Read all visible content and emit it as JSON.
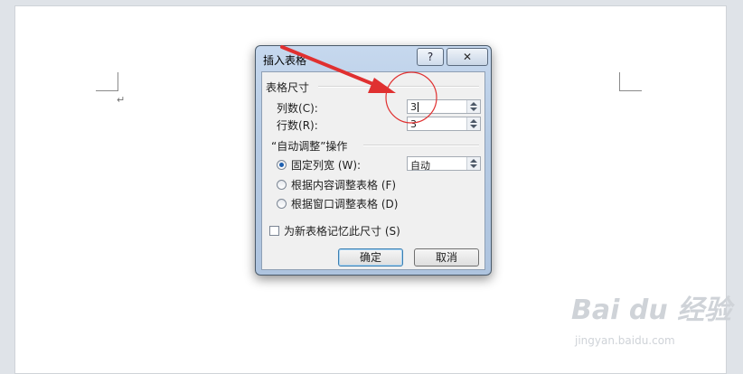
{
  "document": {
    "paragraph_mark": "↵"
  },
  "dialog": {
    "title": "插入表格",
    "help_button": "?",
    "close_button": "✕",
    "table_size": {
      "group_label": "表格尺寸",
      "columns_label": "列数",
      "columns_shortcut": "(C):",
      "columns_value": "3",
      "rows_label": "行数",
      "rows_shortcut": "(R):",
      "rows_value": "3"
    },
    "autofit": {
      "group_label": "“自动调整”操作",
      "options": [
        {
          "label": "固定列宽 (W):",
          "selected": true
        },
        {
          "label": "根据内容调整表格 (F)",
          "selected": false
        },
        {
          "label": "根据窗口调整表格 (D)",
          "selected": false
        }
      ],
      "fixed_width_value": "自动"
    },
    "remember_dimensions": {
      "label": "为新表格记忆此尺寸 (S)",
      "checked": false
    },
    "ok_button": "确定",
    "cancel_button": "取消"
  },
  "annotation": {
    "color": "#e03030"
  },
  "watermark": {
    "brand": "Bai du 经验",
    "url": "jingyan.baidu.com"
  }
}
